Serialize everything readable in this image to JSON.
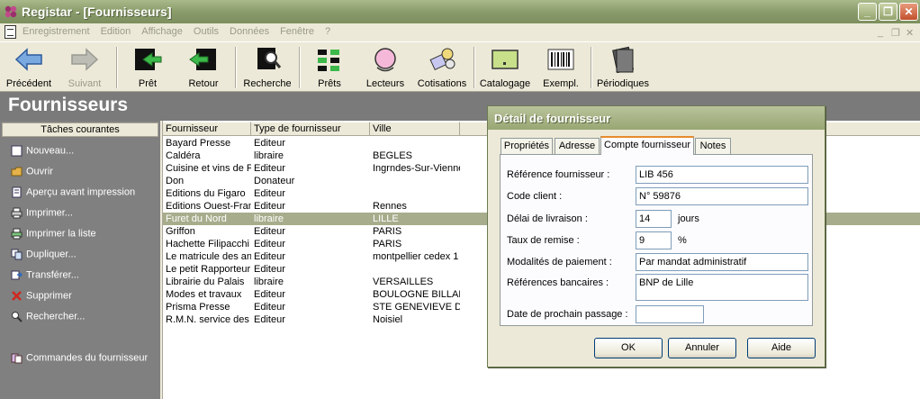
{
  "window": {
    "title": "Registar - [Fournisseurs]"
  },
  "menu": {
    "items": [
      "Enregistrement",
      "Edition",
      "Affichage",
      "Outils",
      "Données",
      "Fenêtre",
      "?"
    ]
  },
  "toolbar": {
    "precedent": "Précédent",
    "suivant": "Suivant",
    "pret": "Prêt",
    "retour": "Retour",
    "recherche": "Recherche",
    "prets": "Prêts",
    "lecteurs": "Lecteurs",
    "cotisations": "Cotisations",
    "catalogage": "Catalogage",
    "exempl": "Exempl.",
    "periodiques": "Périodiques"
  },
  "page": {
    "title": "Fournisseurs"
  },
  "tasks": {
    "header": "Tâches courantes",
    "items": [
      "Nouveau...",
      "Ouvrir",
      "Aperçu avant impression",
      "Imprimer...",
      "Imprimer la liste",
      "Dupliquer...",
      "Transférer...",
      "Supprimer",
      "Rechercher...",
      "Commandes du fournisseur"
    ]
  },
  "grid": {
    "columns": [
      "Fournisseur",
      "Type de fournisseur",
      "Ville"
    ],
    "rows": [
      [
        "Bayard Presse",
        "Editeur",
        ""
      ],
      [
        "Caldéra",
        "libraire",
        "BEGLES"
      ],
      [
        "Cuisine et vins de Fr",
        "Editeur",
        "Ingrndes-Sur-Vienne"
      ],
      [
        "Don",
        "Donateur",
        ""
      ],
      [
        "Editions du Figaro",
        "Editeur",
        ""
      ],
      [
        "Editions Ouest-Franc",
        "Editeur",
        "Rennes"
      ],
      [
        "Furet du Nord",
        "libraire",
        "LILLE"
      ],
      [
        "Griffon",
        "Editeur",
        "PARIS"
      ],
      [
        "Hachette Filipacchi",
        "Editeur",
        "PARIS"
      ],
      [
        "Le matricule des ang",
        "Editeur",
        "montpellier cedex 1"
      ],
      [
        "Le petit Rapporteur",
        "Editeur",
        ""
      ],
      [
        "Librairie du Palais",
        "libraire",
        "VERSAILLES"
      ],
      [
        "Modes et travaux",
        "Editeur",
        "BOULOGNE BILLAN"
      ],
      [
        "Prisma Presse",
        "Editeur",
        "STE GENEVIEVE D"
      ],
      [
        "R.M.N. service des",
        "Editeur",
        "Noisiel"
      ]
    ],
    "selected_row": 6
  },
  "dialog": {
    "title": "Détail de fournisseur",
    "tabs": [
      "Propriétés",
      "Adresse",
      "Compte fournisseur",
      "Notes"
    ],
    "active_tab": 2,
    "fields": {
      "reference_label": "Référence fournisseur :",
      "reference_value": "LIB 456",
      "code_client_label": "Code client :",
      "code_client_value": "N° 59876",
      "delai_label": "Délai de livraison :",
      "delai_value": "14",
      "delai_unit": "jours",
      "taux_label": "Taux de remise :",
      "taux_value": "9",
      "taux_unit": "%",
      "modalites_label": "Modalités de paiement :",
      "modalites_value": "Par mandat administratif",
      "references_bancaires_label": "Références bancaires :",
      "references_bancaires_value": "BNP de Lille",
      "date_label": "Date de prochain passage :",
      "date_value": ""
    },
    "buttons": {
      "ok": "OK",
      "annuler": "Annuler",
      "aide": "Aide"
    }
  }
}
